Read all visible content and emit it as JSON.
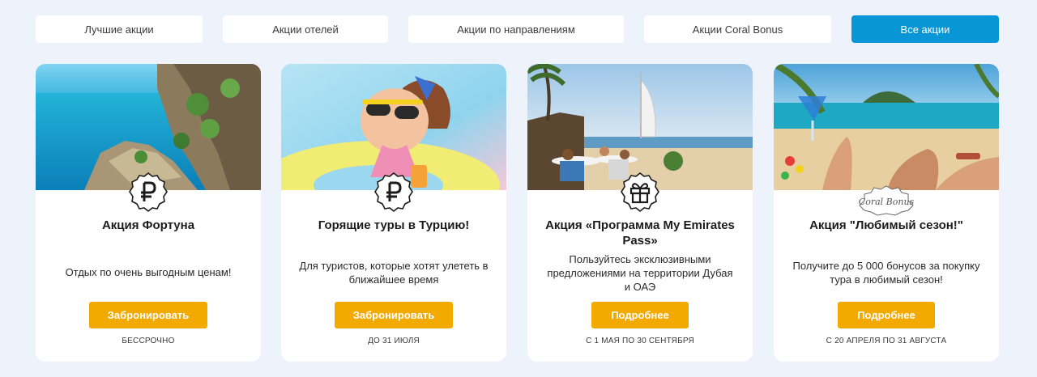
{
  "tabs": [
    {
      "label": "Лучшие акции",
      "active": false
    },
    {
      "label": "Акции отелей",
      "active": false
    },
    {
      "label": "Акции по направлениям",
      "active": false
    },
    {
      "label": "Акции Coral Bonus",
      "active": false
    },
    {
      "label": "Все акции",
      "active": true
    }
  ],
  "cards": [
    {
      "image": "coastal-cliffs-photo",
      "badge_icon": "ruble-icon",
      "title": "Акция Фортуна",
      "description": "Отдых по очень выгодным ценам!",
      "button": "Забронировать",
      "dates": "БЕССРОЧНО"
    },
    {
      "image": "girl-in-sunglasses-photo",
      "badge_icon": "ruble-icon",
      "title": "Горящие туры в Турцию!",
      "description": "Для туристов, которые хотят улететь в ближайшее время",
      "button": "Забронировать",
      "dates": "ДО 31 ИЮЛЯ"
    },
    {
      "image": "dubai-beach-photo",
      "badge_icon": "gift-icon",
      "title": "Акция «Программа My Emirates Pass»",
      "description": "Пользуйтесь эксклюзивными предложениями на территории Дубая и ОАЭ",
      "button": "Подробнее",
      "dates": "С 1 МАЯ ПО 30 СЕНТЯБРЯ"
    },
    {
      "image": "tropical-beach-cocktail-photo",
      "badge_icon": "coral-bonus-logo",
      "title": "Акция \"Любимый сезон!\"",
      "description": "Получите до 5 000 бонусов за покупку тура в любимый сезон!",
      "button": "Подробнее",
      "dates": "С 20 АПРЕЛЯ ПО 31 АВГУСТА"
    }
  ],
  "colors": {
    "background": "#eef3fb",
    "active_tab": "#0996d6",
    "button": "#f2a900"
  }
}
